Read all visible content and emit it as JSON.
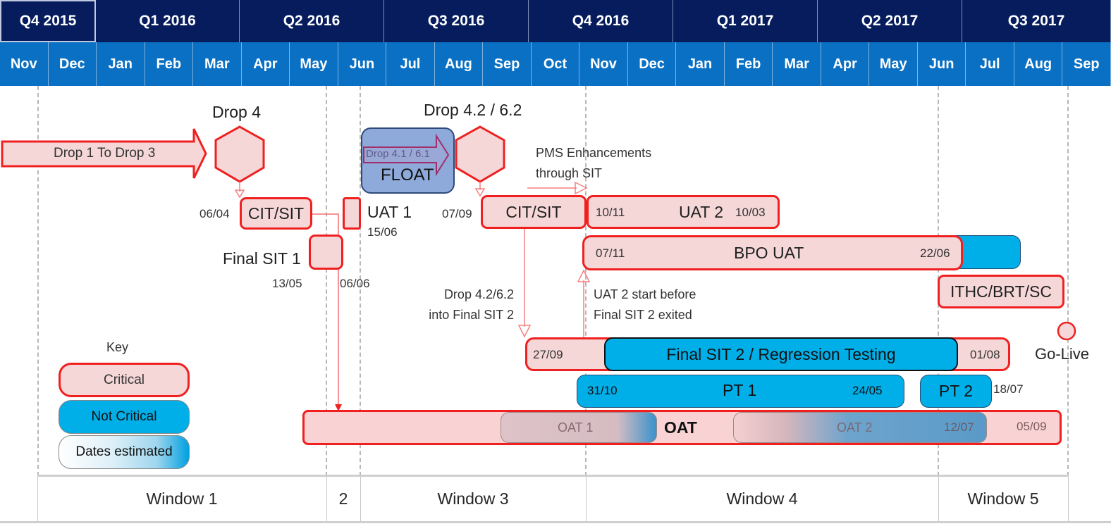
{
  "header": {
    "quarters": [
      "Q4 2015",
      "Q1 2016",
      "Q2 2016",
      "Q3 2016",
      "Q4 2016",
      "Q1 2017",
      "Q2 2017",
      "Q3 2017"
    ],
    "months": [
      "Nov",
      "Dec",
      "Jan",
      "Feb",
      "Mar",
      "Apr",
      "May",
      "Jun",
      "Jul",
      "Aug",
      "Sep",
      "Oct",
      "Nov",
      "Dec",
      "Jan",
      "Feb",
      "Mar",
      "Apr",
      "May",
      "Jun",
      "Jul",
      "Aug",
      "Sep"
    ]
  },
  "colors": {
    "quarter_bg": "#061c5c",
    "month_bg": "#0a70c4",
    "critical_fill": "#f6d7d7",
    "critical_border": "#f02020",
    "not_critical_fill": "#00aee8",
    "float_fill": "#8eaadb",
    "float_border": "#2f4a7a"
  },
  "milestones": {
    "drop4": "Drop 4",
    "drop42": "Drop 4.2 / 6.2",
    "golive": "Go-Live"
  },
  "tasks": {
    "drop1to3": "Drop 1 To Drop 3",
    "float": "FLOAT",
    "drop41": "Drop 4.1 / 6.1",
    "cit1": {
      "label": "CIT/SIT",
      "start": "06/04"
    },
    "uat1": {
      "label": "UAT 1",
      "end": "15/06"
    },
    "finalsit1": {
      "label": "Final SIT 1",
      "start": "13/05",
      "end": "06/06"
    },
    "cit2": {
      "label": "CIT/SIT",
      "start": "07/09"
    },
    "uat2": {
      "label": "UAT 2",
      "start": "10/11",
      "end": "10/03"
    },
    "bpouat": {
      "label": "BPO UAT",
      "start": "07/11",
      "end": "22/06"
    },
    "ithc": {
      "label": "ITHC/BRT/SC"
    },
    "finalsit2": {
      "label": "Final SIT 2 / Regression Testing",
      "start": "27/09",
      "end": "01/08"
    },
    "pt1": {
      "label": "PT 1",
      "start": "31/10",
      "end": "24/05"
    },
    "pt2": {
      "label": "PT 2",
      "end": "18/07"
    },
    "oat": {
      "label": "OAT",
      "oat1": "OAT 1",
      "oat2": "OAT 2",
      "oat2_end": "12/07",
      "end": "05/09"
    }
  },
  "annotations": {
    "pms_line1": "PMS Enhancements",
    "pms_line2": "through SIT",
    "drop_into_line1": "Drop 4.2/6.2",
    "drop_into_line2": "into Final SIT 2",
    "uat2_before_line1": "UAT 2 start before",
    "uat2_before_line2": "Final SIT 2 exited"
  },
  "key": {
    "title": "Key",
    "critical": "Critical",
    "not_critical": "Not Critical",
    "estimated": "Dates estimated"
  },
  "windows": [
    "Window 1",
    "2",
    "Window 3",
    "Window 4",
    "Window 5"
  ]
}
